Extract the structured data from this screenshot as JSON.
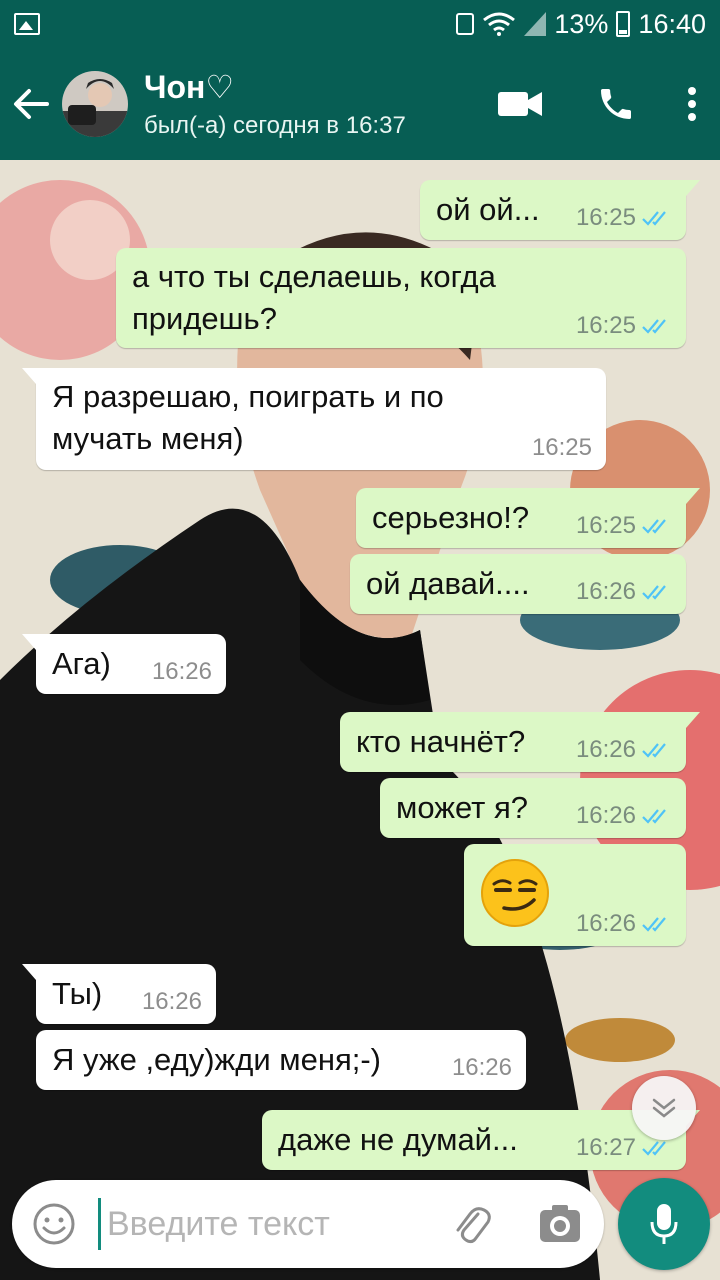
{
  "status_bar": {
    "battery_percent": "13%",
    "time": "16:40"
  },
  "header": {
    "contact_name": "Чон♡",
    "last_seen": "был(-а) сегодня в 16:37"
  },
  "messages": [
    {
      "direction": "out",
      "text": "ой ой...",
      "time": "16:25",
      "read": true
    },
    {
      "direction": "out",
      "text": "а что ты сделаешь, когда придешь?",
      "time": "16:25",
      "read": true
    },
    {
      "direction": "in",
      "text": "Я разрешаю, поиграть и по мучать меня)",
      "time": "16:25"
    },
    {
      "direction": "out",
      "text": "серьезно!?",
      "time": "16:25",
      "read": true
    },
    {
      "direction": "out",
      "text": "ой давай....",
      "time": "16:26",
      "read": true
    },
    {
      "direction": "in",
      "text": "Ага)",
      "time": "16:26"
    },
    {
      "direction": "out",
      "text": "кто начнёт?",
      "time": "16:26",
      "read": true
    },
    {
      "direction": "out",
      "text": "может я?",
      "time": "16:26",
      "read": true
    },
    {
      "direction": "out",
      "text": "😏",
      "time": "16:26",
      "read": true,
      "emoji": "smirking-face"
    },
    {
      "direction": "in",
      "text": "Ты)",
      "time": "16:26"
    },
    {
      "direction": "in",
      "text": "Я уже ,еду)жди меня;-)",
      "time": "16:26"
    },
    {
      "direction": "out",
      "text": "даже не думай...",
      "time": "16:27",
      "read": true
    }
  ],
  "input": {
    "placeholder": "Введите текст",
    "value": ""
  },
  "colors": {
    "header": "#075e54",
    "accent": "#128c7e",
    "outgoing_bubble": "#dcf8c6",
    "incoming_bubble": "#ffffff",
    "read_ticks": "#4fc3f7"
  },
  "icons": [
    "back-arrow-icon",
    "video-call-icon",
    "phone-icon",
    "more-vert-icon",
    "emoji-icon",
    "attach-icon",
    "camera-icon",
    "mic-icon",
    "scroll-down-icon"
  ]
}
